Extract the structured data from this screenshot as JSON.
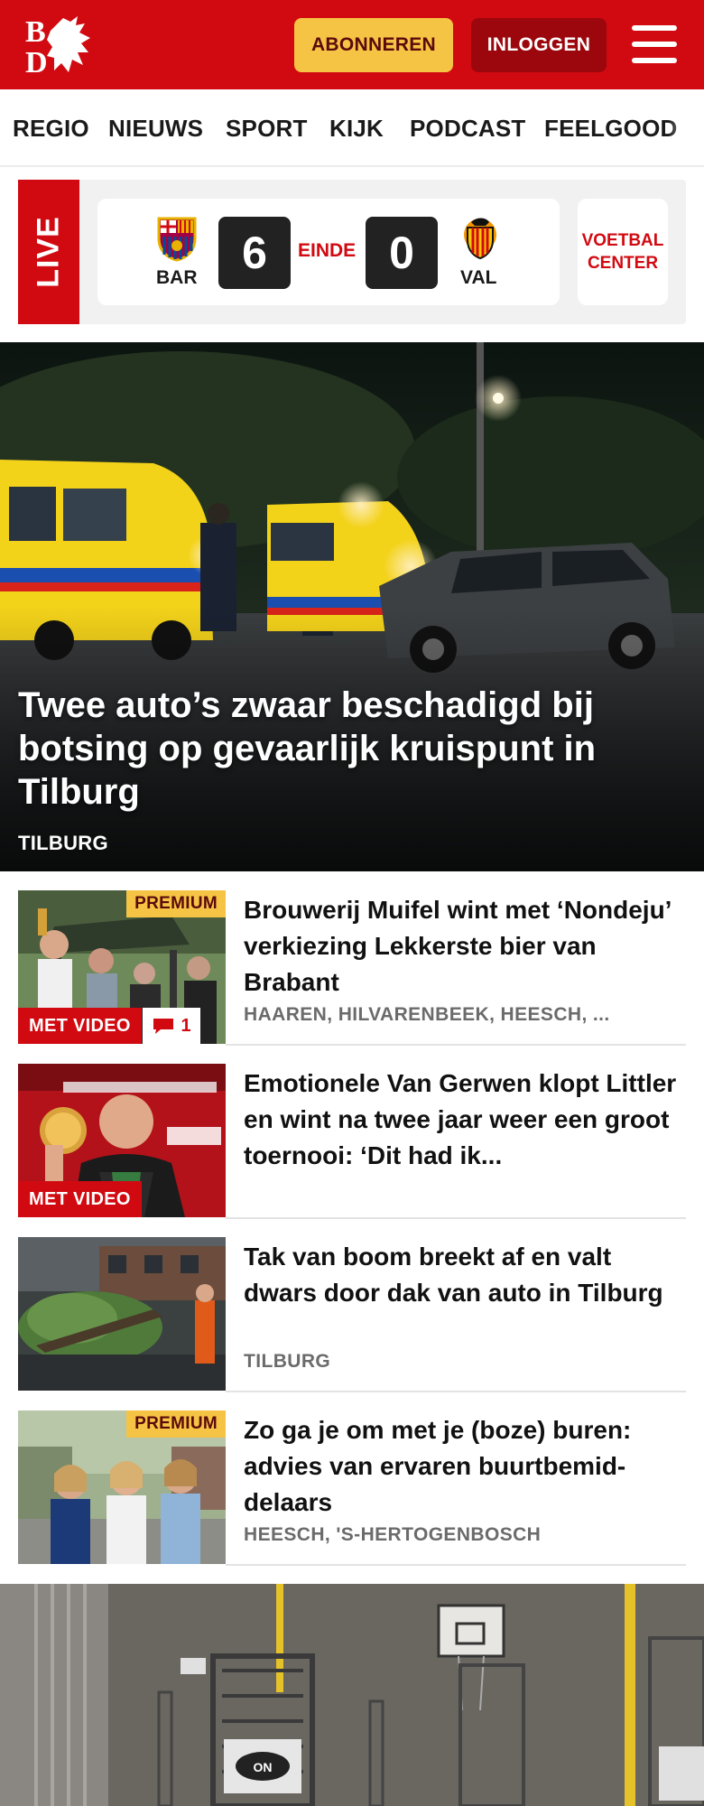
{
  "header": {
    "logo_letters": [
      "B",
      "D"
    ],
    "subscribe_label": "ABONNEREN",
    "login_label": "INLOGGEN",
    "brand_color": "#d10a11",
    "subscribe_color": "#f6c445"
  },
  "nav": {
    "items": [
      "REGIO",
      "NIEUWS",
      "SPORT",
      "KIJK",
      "PODCAST",
      "FEELGOOD"
    ]
  },
  "live": {
    "tag": "LIVE",
    "home_team": "BAR",
    "home_score": "6",
    "status": "EINDE",
    "away_score": "0",
    "away_team": "VAL",
    "center_label": "VOETBAL CENTER"
  },
  "hero": {
    "title": "Twee auto’s zwaar beschadigd bij botsing op gevaarlijk kruispunt in Tilburg",
    "location": "TILBURG"
  },
  "articles": [
    {
      "title": "Brouwerij Muifel wint met ‘Nondeju’ verkiezing Lekkerste bier van Brabant",
      "location": "HAAREN, HILVARENBEEK, HEESCH, ...",
      "premium": "PREMIUM",
      "video": "MET VIDEO",
      "comments": "1"
    },
    {
      "title": "Emotionele Van Gerwen klopt Littler en wint na twee jaar weer een groot toernooi: ‘Dit had ik...",
      "location": "",
      "video": "MET VIDEO"
    },
    {
      "title": "Tak van boom breekt af en valt dwars door dak van auto in Tilburg",
      "location": "TILBURG"
    },
    {
      "title": "Zo ga je om met je (boze) buren: advies van ervaren buurtbemid-delaars",
      "location": "HEESCH, 'S-HERTOGENBOSCH",
      "premium": "PREMIUM"
    }
  ]
}
